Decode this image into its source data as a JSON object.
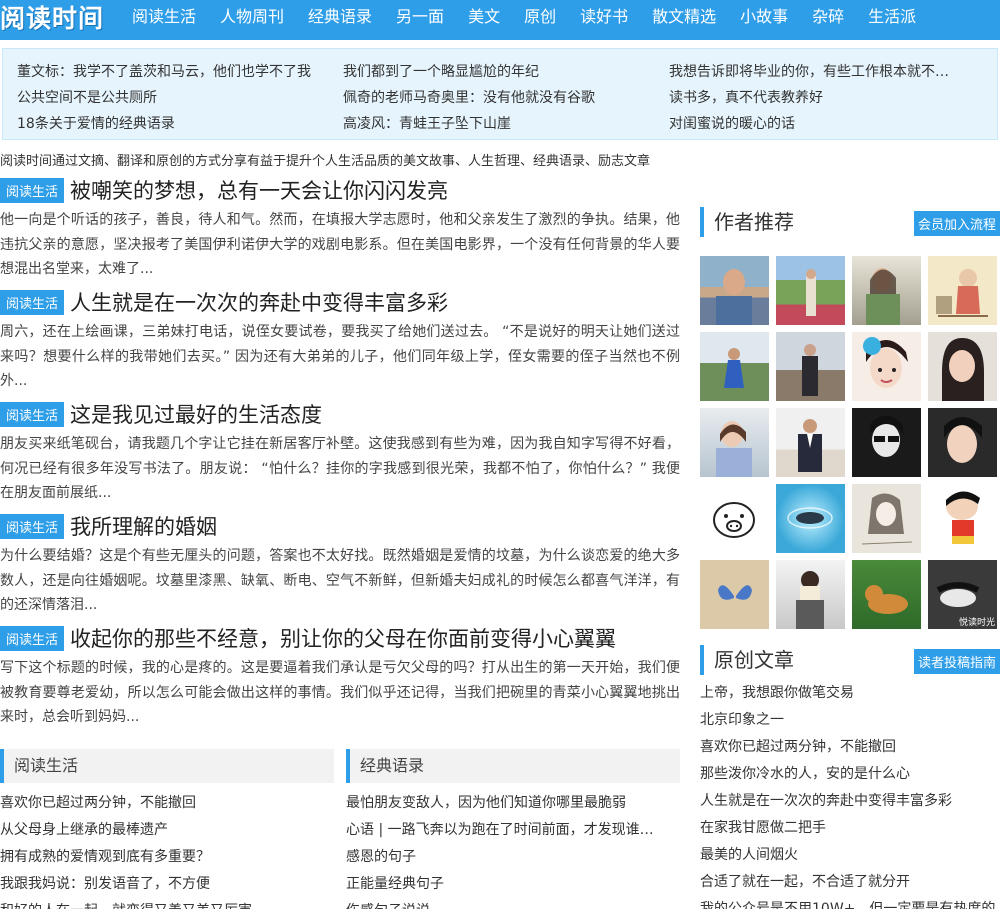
{
  "header": {
    "logo": "阅读时间",
    "nav": [
      "阅读生活",
      "人物周刊",
      "经典语录",
      "另一面",
      "美文",
      "原创",
      "读好书",
      "散文精选",
      "小故事",
      "杂碎",
      "生活派"
    ]
  },
  "headlines": [
    [
      "董文标：我学不了盖茨和马云，他们也学不了我",
      "我们都到了一个略显尴尬的年纪",
      "我想告诉即将毕业的你，有些工作根本就不…"
    ],
    [
      "公共空间不是公共厕所",
      "佩奇的老师马奇奥里：没有他就没有谷歌",
      "读书多，真不代表教养好"
    ],
    [
      "18条关于爱情的经典语录",
      "高凌风：青蛙王子坠下山崖",
      "对闺蜜说的暖心的话"
    ]
  ],
  "site_description": "阅读时间通过文摘、翻译和原创的方式分享有益于提升个人生活品质的美文故事、人生哲理、经典语录、励志文章",
  "articles": [
    {
      "tag": "阅读生活",
      "title": "被嘲笑的梦想，总有一天会让你闪闪发亮",
      "excerpt": "他一向是个听话的孩子，善良，待人和气。然而，在填报大学志愿时，他和父亲发生了激烈的争执。结果，他违抗父亲的意愿，坚决报考了美国伊利诺伊大学的戏剧电影系。但在美国电影界，一个没有任何背景的华人要想混出名堂来，太难了..."
    },
    {
      "tag": "阅读生活",
      "title": "人生就是在一次次的奔赴中变得丰富多彩",
      "excerpt": "周六，还在上绘画课，三弟妹打电话，说侄女要试卷，要我买了给她们送过去。 “不是说好的明天让她们送过来吗？想要什么样的我带她们去买。” 因为还有大弟弟的儿子，他们同年级上学，侄女需要的侄子当然也不例外..."
    },
    {
      "tag": "阅读生活",
      "title": "这是我见过最好的生活态度",
      "excerpt": "朋友买来纸笔砚台，请我题几个字让它挂在新居客厅补壁。这使我感到有些为难，因为我自知字写得不好看，何况已经有很多年没写书法了。朋友说： “怕什么？挂你的字我感到很光荣，我都不怕了，你怕什么？” 我便在朋友面前展纸..."
    },
    {
      "tag": "阅读生活",
      "title": "我所理解的婚姻",
      "excerpt": "为什么要结婚？这是个有些无厘头的问题，答案也不太好找。既然婚姻是爱情的坟墓，为什么谈恋爱的绝大多数人，还是向往婚姻呢。坟墓里漆黑、缺氧、断电、空气不新鲜，但新婚夫妇成礼的时候怎么都喜气洋洋，有的还深情落泪..."
    },
    {
      "tag": "阅读生活",
      "title": "收起你的那些不经意，别让你的父母在你面前变得小心翼翼",
      "excerpt": "写下这个标题的时候，我的心是疼的。这是要逼着我们承认是亏欠父母的吗？打从出生的第一天开始，我们便被教育要尊老爱幼，所以怎么可能会做出这样的事情。我们似乎还记得，当我们把碗里的青菜小心翼翼地挑出来时，总会听到妈妈..."
    }
  ],
  "section_left": {
    "title": "阅读生活",
    "items": [
      "喜欢你已超过两分钟，不能撤回",
      "从父母身上继承的最棒遗产",
      "拥有成熟的爱情观到底有多重要？",
      "我跟我妈说：别发语音了，不方便",
      "和好的人在一起，就变得又善又美又厉害"
    ]
  },
  "section_right": {
    "title": "经典语录",
    "items": [
      "最怕朋友变敌人，因为他们知道你哪里最脆弱",
      "心语 | 一路飞奔以为跑在了时间前面，才发现谁…",
      "感恩的句子",
      "正能量经典句子",
      "伤感句子说说"
    ]
  },
  "sidebar": {
    "authors_title": "作者推荐",
    "authors_button": "会员加入流程",
    "avatar_caption": "悦读时光",
    "original_title": "原创文章",
    "original_button": "读者投稿指南",
    "original_items": [
      "上帝，我想跟你做笔交易",
      "北京印象之一",
      "喜欢你已超过两分钟，不能撤回",
      "那些泼你冷水的人，安的是什么心",
      "人生就是在一次次的奔赴中变得丰富多彩",
      "在家我甘愿做二把手",
      "最美的人间烟火",
      "合适了就在一起，不合适了就分开",
      "我的公众号是不用10W+，但一定要是有热度的"
    ]
  },
  "colors": {
    "accent": "#2f9ee9",
    "headline_bg": "#e6f5fd"
  }
}
